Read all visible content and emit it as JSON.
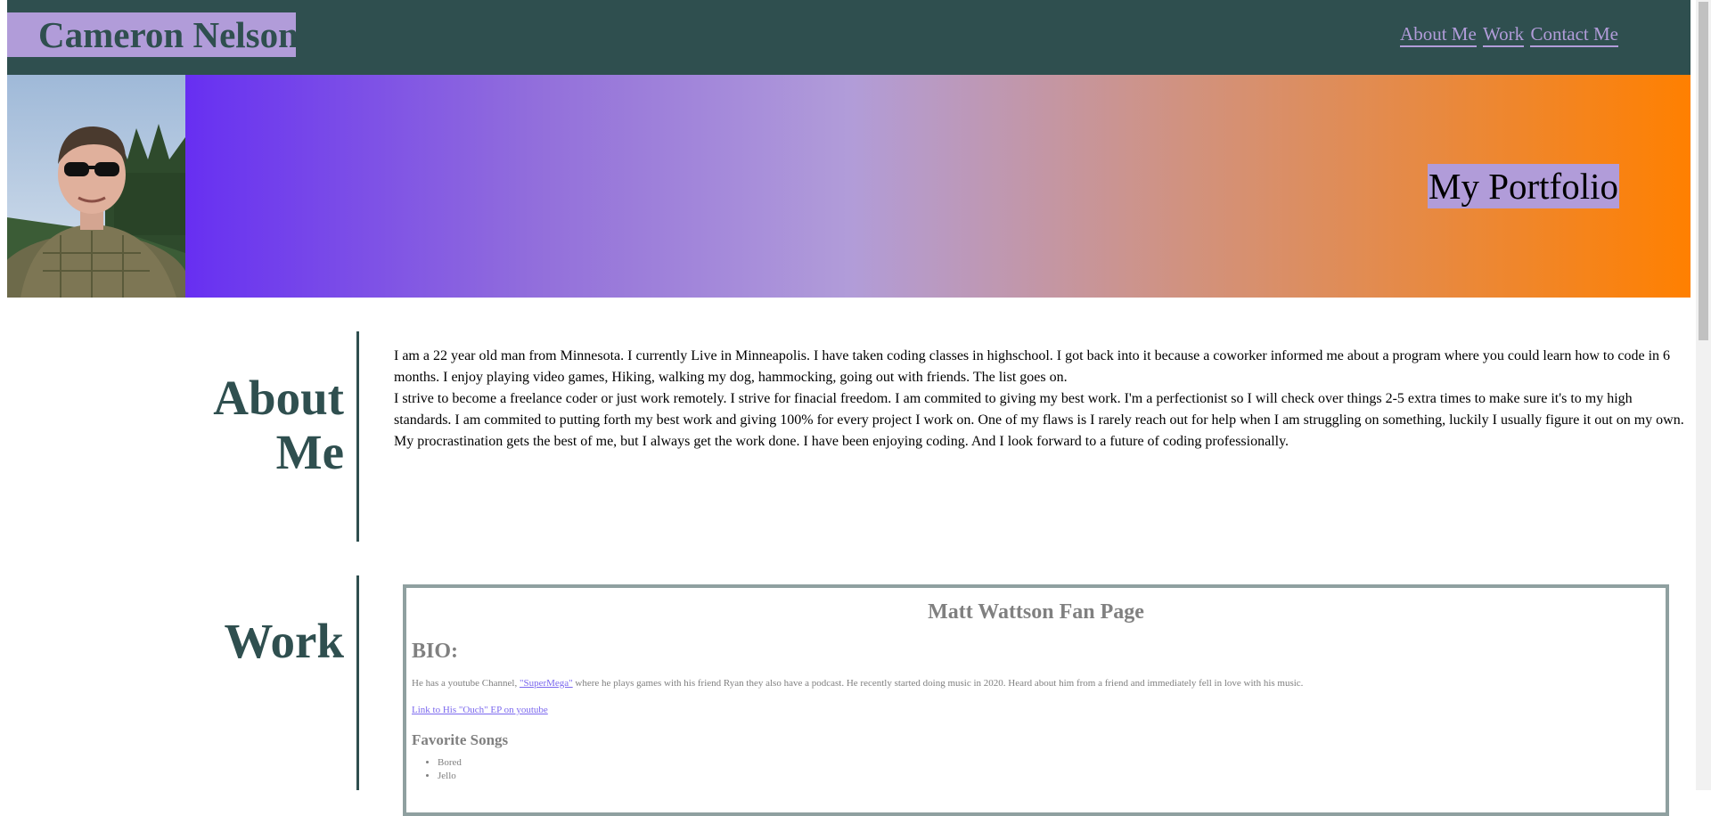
{
  "header": {
    "name": "Cameron Nelson",
    "nav": [
      "About Me",
      "Work",
      "Contact Me"
    ]
  },
  "hero": {
    "title": "My Portfolio",
    "avatar_alt": "profile-photo"
  },
  "about": {
    "heading_line1": "About",
    "heading_line2": "Me",
    "paragraph1": "I am a 22 year old man from Minnesota. I currently Live in Minneapolis. I have taken coding classes in highschool. I got back into it because a coworker informed me about a program where you could learn how to code in 6 months. I enjoy playing video games, Hiking, walking my dog, hammocking, going out with friends. The list goes on.",
    "paragraph2": "I strive to become a freelance coder or just work remotely. I strive for finacial freedom. I am commited to giving my best work. I'm a perfectionist so I will check over things 2-5 extra times to make sure it's to my high standards. I am commited to putting forth my best work and giving 100% for every project I work on. One of my flaws is I rarely reach out for help when I am struggling on something, luckily I usually figure it out on my own. My procrastination gets the best of me, but I always get the work done. I have been enjoying coding. And I look forward to a future of coding professionally."
  },
  "work": {
    "heading": "Work",
    "project": {
      "title": "Matt Wattson Fan Page",
      "bio_heading": "BIO:",
      "bio_before": "He has a youtube Channel, ",
      "bio_link": "\"SuperMega\"",
      "bio_after": " where he plays games with his friend Ryan they also have a podcast. He recently started doing music in 2020. Heard about him from a friend and immediately fell in love with his music.",
      "ep_link": "Link to His \"Ouch\" EP on youtube",
      "songs_heading": "Favorite Songs",
      "songs": [
        "Bored",
        "Jello"
      ]
    }
  },
  "colors": {
    "header_bg": "#2f4f4f",
    "accent_lavender": "#b19cd9",
    "gradient_start": "#5100ff",
    "gradient_end": "#ff8000"
  }
}
